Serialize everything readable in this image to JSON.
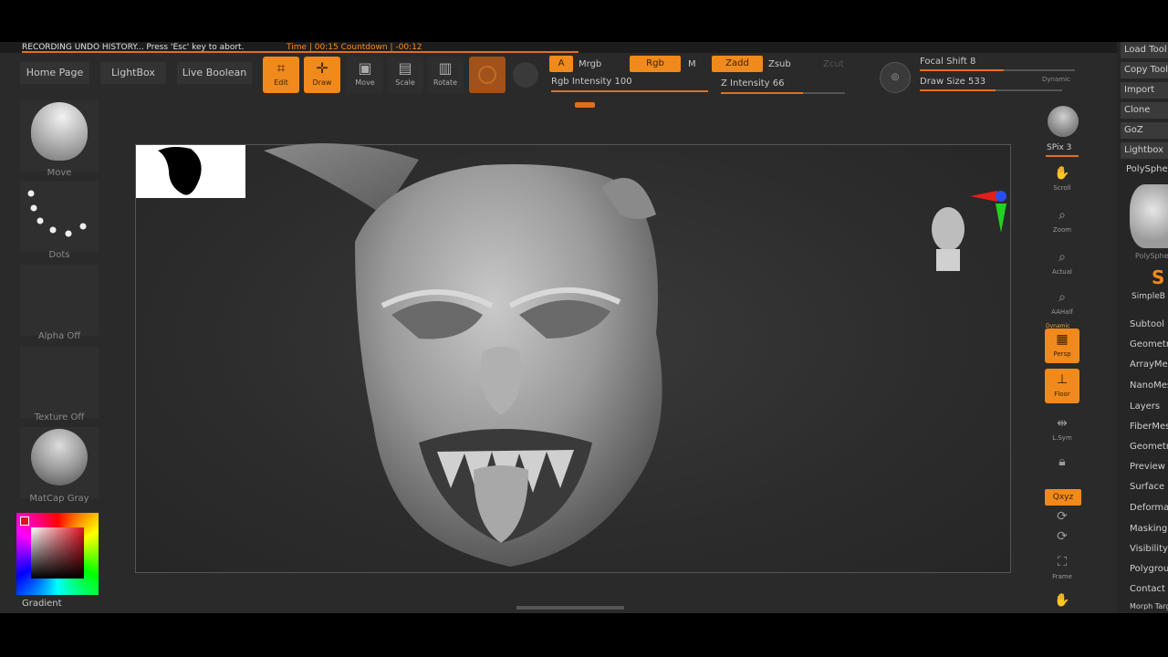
{
  "recording": {
    "message": "RECORDING UNDO HISTORY... Press 'Esc' key to abort.",
    "timer": "Time | 00:15 Countdown | -00:12"
  },
  "nav": {
    "home_page": "Home Page",
    "lightbox": "LightBox",
    "live_boolean": "Live Boolean"
  },
  "tools": [
    {
      "label": "Edit",
      "icon": "edit-icon"
    },
    {
      "label": "Draw",
      "icon": "draw-icon"
    },
    {
      "label": "Move",
      "icon": "move-icon"
    },
    {
      "label": "Scale",
      "icon": "scale-icon"
    },
    {
      "label": "Rotate",
      "icon": "rotate-icon"
    }
  ],
  "brush_settings": {
    "a_label": "A",
    "mrgb": "Mrgb",
    "rgb": "Rgb",
    "m": "M",
    "zadd": "Zadd",
    "zsub": "Zsub",
    "zcut": "Zcut",
    "rgb_intensity": "Rgb Intensity 100",
    "z_intensity": "Z Intensity 66",
    "focal_shift": "Focal Shift 8",
    "draw_size": "Draw Size 533",
    "dynamic": "Dynamic",
    "rgb_intensity_value": 1.0,
    "z_intensity_value": 0.66,
    "focal_shift_value": 0.54,
    "draw_size_value": 0.53
  },
  "left_shelf": {
    "brush": "Move",
    "stroke": "Dots",
    "alpha": "Alpha Off",
    "texture": "Texture Off",
    "material": "MatCap Gray",
    "gradient": "Gradient"
  },
  "right_shelf": {
    "spix": "SPix 3",
    "items": [
      "Scroll",
      "Zoom",
      "Actual",
      "AAHalf",
      "Persp",
      "Floor",
      "L.Sym",
      "",
      "Qxyz",
      "",
      "",
      "Frame",
      ""
    ],
    "dynamic_tag": "Dynamic"
  },
  "tool_panel": {
    "buttons": [
      "Load Tool",
      "Copy Tool",
      "Import",
      "Clone",
      "GoZ",
      "Lightbox",
      "PolySphere"
    ],
    "thumb_label": "PolySphere",
    "simple_label": "SimpleB",
    "sections": [
      "Subtool",
      "Geometry",
      "ArrayMesh",
      "NanoMesh",
      "Layers",
      "FiberMesh",
      "Geometry HD",
      "Preview",
      "Surface",
      "Deformation",
      "Masking",
      "Visibility",
      "Polygroups",
      "Contact",
      "Morph Target"
    ]
  },
  "colors": {
    "accent": "#f08a1c",
    "panel": "#2a2a2a",
    "canvas_border": "#555555"
  }
}
